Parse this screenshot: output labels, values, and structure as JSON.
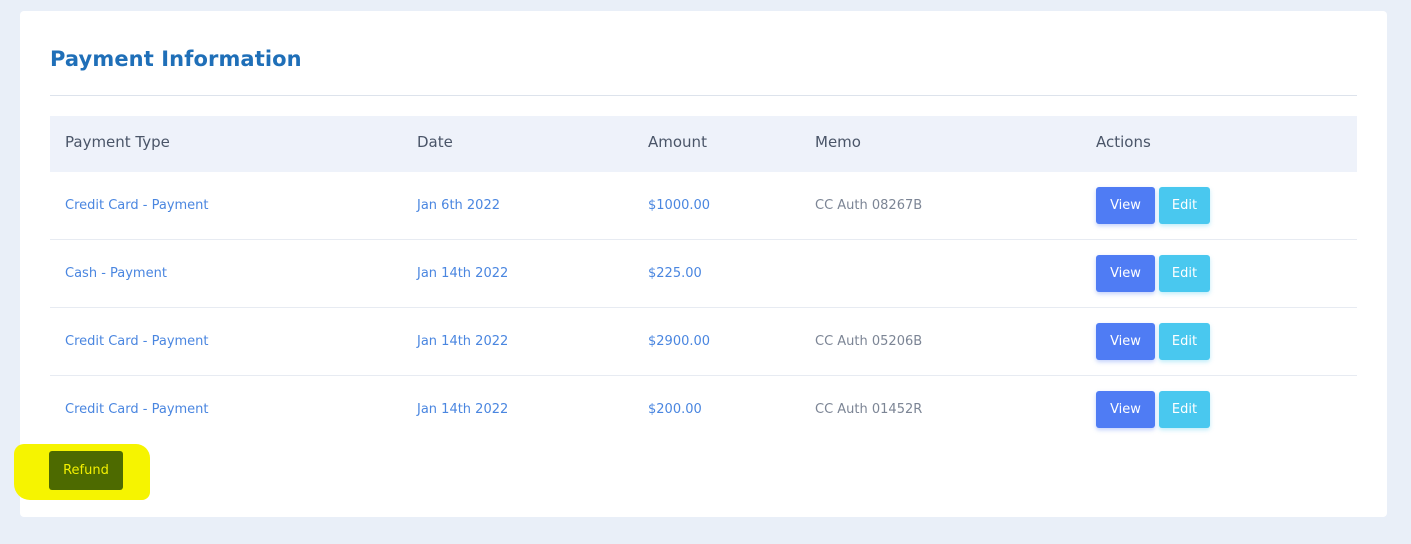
{
  "section": {
    "title": "Payment Information"
  },
  "table": {
    "columns": [
      "Payment Type",
      "Date",
      "Amount",
      "Memo",
      "Actions"
    ],
    "rows": [
      {
        "type": "Credit Card - Payment",
        "date": "Jan 6th 2022",
        "amount": "$1000.00",
        "memo": "CC Auth 08267B"
      },
      {
        "type": "Cash - Payment",
        "date": "Jan 14th 2022",
        "amount": "$225.00",
        "memo": ""
      },
      {
        "type": "Credit Card - Payment",
        "date": "Jan 14th 2022",
        "amount": "$2900.00",
        "memo": "CC Auth 05206B"
      },
      {
        "type": "Credit Card - Payment",
        "date": "Jan 14th 2022",
        "amount": "$200.00",
        "memo": "CC Auth 01452R"
      }
    ],
    "view_label": "View",
    "edit_label": "Edit"
  },
  "refund_label": "Refund",
  "colors": {
    "title": "#1f6fb8",
    "view_button": "#4f7cf4",
    "edit_button": "#49c8ef",
    "refund_button": "#4d6a00",
    "highlight": "#f6f400"
  }
}
